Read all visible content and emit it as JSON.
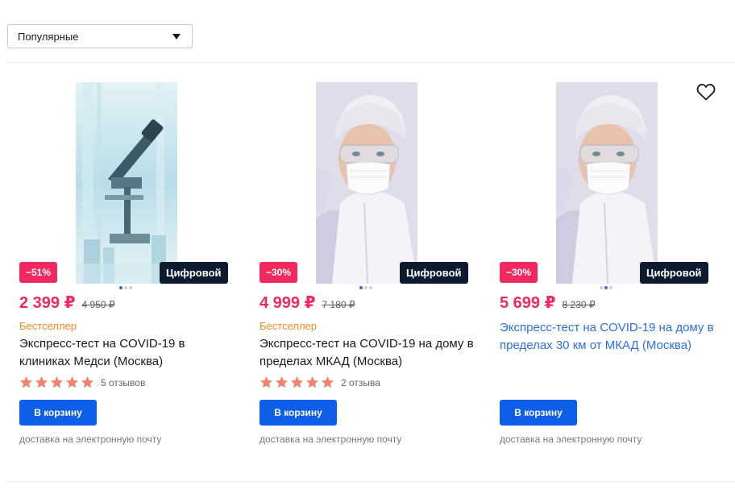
{
  "sort": {
    "selected": "Популярные"
  },
  "products": [
    {
      "image": "microscope-photo",
      "sale_badge": "−51%",
      "digital_badge": "Цифровой",
      "price": "2 399 ₽",
      "old_price": "4 950 ₽",
      "label": "Бестселлер",
      "title": "Экспресс-тест на COVID-19 в клиниках Медси (Москва)",
      "rating": 5,
      "reviews": "5 отзывов",
      "cart_label": "В корзину",
      "delivery": "доставка на электронную почту"
    },
    {
      "image": "medical-worker-photo",
      "sale_badge": "−30%",
      "digital_badge": "Цифровой",
      "price": "4 999 ₽",
      "old_price": "7 180 ₽",
      "label": "Бестселлер",
      "title": "Экспресс-тест на COVID-19 на дому в пределах МКАД (Москва)",
      "rating": 5,
      "reviews": "2 отзыва",
      "cart_label": "В корзину",
      "delivery": "доставка на электронную почту"
    },
    {
      "image": "medical-worker-photo",
      "sale_badge": "−30%",
      "digital_badge": "Цифровой",
      "price": "5 699 ₽",
      "old_price": "8 230 ₽",
      "title": "Экспресс-тест на COVID-19 на дому в пределах 30 км от МКАД (Москва)",
      "cart_label": "В корзину",
      "delivery": "доставка на электронную почту",
      "favorite_icon": "heart-outline-icon"
    }
  ],
  "colors": {
    "sale": "#f2295f",
    "button": "#0d5fe8",
    "bestseller": "#f08a24",
    "link": "#2b6fe0",
    "star": "#f2836b",
    "digital_badge": "#0d1b2e"
  }
}
